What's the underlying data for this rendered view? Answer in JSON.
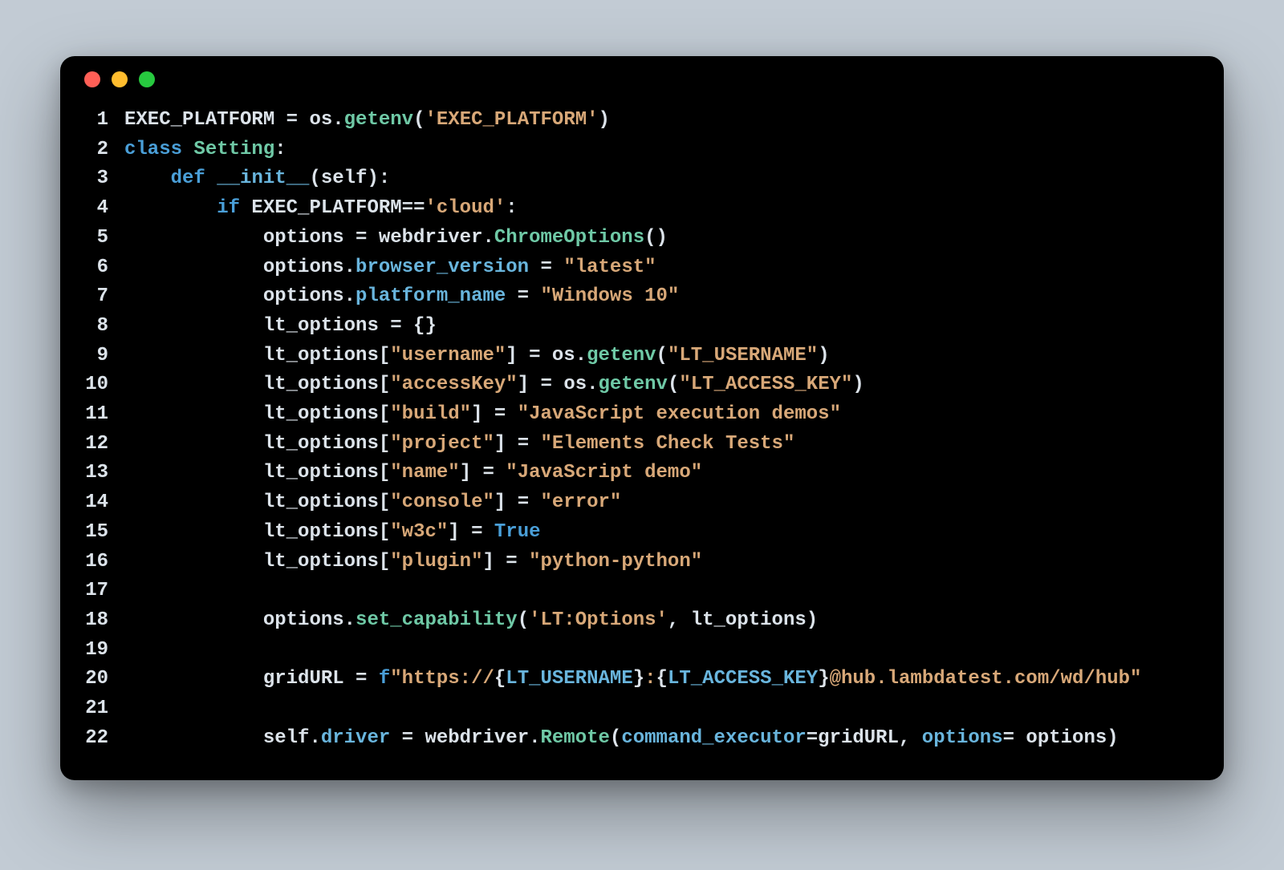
{
  "window": {
    "traffic_lights": [
      "red",
      "yellow",
      "green"
    ]
  },
  "code": {
    "lines": [
      {
        "n": "1",
        "tokens": [
          {
            "t": "EXEC_PLATFORM = os.",
            "c": "tok-id"
          },
          {
            "t": "getenv",
            "c": "tok-fn"
          },
          {
            "t": "(",
            "c": "tok-id"
          },
          {
            "t": "'EXEC_PLATFORM'",
            "c": "tok-str"
          },
          {
            "t": ")",
            "c": "tok-id"
          }
        ]
      },
      {
        "n": "2",
        "tokens": [
          {
            "t": "class",
            "c": "tok-kw"
          },
          {
            "t": " ",
            "c": "tok-id"
          },
          {
            "t": "Setting",
            "c": "tok-cls"
          },
          {
            "t": ":",
            "c": "tok-id"
          }
        ]
      },
      {
        "n": "3",
        "tokens": [
          {
            "t": "    ",
            "c": "tok-id"
          },
          {
            "t": "def",
            "c": "tok-kw"
          },
          {
            "t": " ",
            "c": "tok-id"
          },
          {
            "t": "__init__",
            "c": "tok-attr"
          },
          {
            "t": "(",
            "c": "tok-id"
          },
          {
            "t": "self",
            "c": "tok-id"
          },
          {
            "t": "):",
            "c": "tok-id"
          }
        ]
      },
      {
        "n": "4",
        "tokens": [
          {
            "t": "        ",
            "c": "tok-id"
          },
          {
            "t": "if",
            "c": "tok-kw"
          },
          {
            "t": " EXEC_PLATFORM==",
            "c": "tok-id"
          },
          {
            "t": "'cloud'",
            "c": "tok-str"
          },
          {
            "t": ":",
            "c": "tok-id"
          }
        ]
      },
      {
        "n": "5",
        "tokens": [
          {
            "t": "            options = webdriver.",
            "c": "tok-id"
          },
          {
            "t": "ChromeOptions",
            "c": "tok-cls"
          },
          {
            "t": "()",
            "c": "tok-id"
          }
        ]
      },
      {
        "n": "6",
        "tokens": [
          {
            "t": "            options.",
            "c": "tok-id"
          },
          {
            "t": "browser_version",
            "c": "tok-attr"
          },
          {
            "t": " = ",
            "c": "tok-id"
          },
          {
            "t": "\"latest\"",
            "c": "tok-str"
          }
        ]
      },
      {
        "n": "7",
        "tokens": [
          {
            "t": "            options.",
            "c": "tok-id"
          },
          {
            "t": "platform_name",
            "c": "tok-attr"
          },
          {
            "t": " = ",
            "c": "tok-id"
          },
          {
            "t": "\"Windows 10\"",
            "c": "tok-str"
          }
        ]
      },
      {
        "n": "8",
        "tokens": [
          {
            "t": "            lt_options = {}",
            "c": "tok-id"
          }
        ]
      },
      {
        "n": "9",
        "tokens": [
          {
            "t": "            lt_options[",
            "c": "tok-id"
          },
          {
            "t": "\"username\"",
            "c": "tok-str"
          },
          {
            "t": "] = os.",
            "c": "tok-id"
          },
          {
            "t": "getenv",
            "c": "tok-fn"
          },
          {
            "t": "(",
            "c": "tok-id"
          },
          {
            "t": "\"LT_USERNAME\"",
            "c": "tok-str"
          },
          {
            "t": ")",
            "c": "tok-id"
          }
        ]
      },
      {
        "n": "10",
        "tokens": [
          {
            "t": "            lt_options[",
            "c": "tok-id"
          },
          {
            "t": "\"accessKey\"",
            "c": "tok-str"
          },
          {
            "t": "] = os.",
            "c": "tok-id"
          },
          {
            "t": "getenv",
            "c": "tok-fn"
          },
          {
            "t": "(",
            "c": "tok-id"
          },
          {
            "t": "\"LT_ACCESS_KEY\"",
            "c": "tok-str"
          },
          {
            "t": ")",
            "c": "tok-id"
          }
        ]
      },
      {
        "n": "11",
        "tokens": [
          {
            "t": "            lt_options[",
            "c": "tok-id"
          },
          {
            "t": "\"build\"",
            "c": "tok-str"
          },
          {
            "t": "] = ",
            "c": "tok-id"
          },
          {
            "t": "\"JavaScript execution demos\"",
            "c": "tok-str"
          }
        ]
      },
      {
        "n": "12",
        "tokens": [
          {
            "t": "            lt_options[",
            "c": "tok-id"
          },
          {
            "t": "\"project\"",
            "c": "tok-str"
          },
          {
            "t": "] = ",
            "c": "tok-id"
          },
          {
            "t": "\"Elements Check Tests\"",
            "c": "tok-str"
          }
        ]
      },
      {
        "n": "13",
        "tokens": [
          {
            "t": "            lt_options[",
            "c": "tok-id"
          },
          {
            "t": "\"name\"",
            "c": "tok-str"
          },
          {
            "t": "] = ",
            "c": "tok-id"
          },
          {
            "t": "\"JavaScript demo\"",
            "c": "tok-str"
          }
        ]
      },
      {
        "n": "14",
        "tokens": [
          {
            "t": "            lt_options[",
            "c": "tok-id"
          },
          {
            "t": "\"console\"",
            "c": "tok-str"
          },
          {
            "t": "] = ",
            "c": "tok-id"
          },
          {
            "t": "\"error\"",
            "c": "tok-str"
          }
        ]
      },
      {
        "n": "15",
        "tokens": [
          {
            "t": "            lt_options[",
            "c": "tok-id"
          },
          {
            "t": "\"w3c\"",
            "c": "tok-str"
          },
          {
            "t": "] = ",
            "c": "tok-id"
          },
          {
            "t": "True",
            "c": "tok-kw"
          }
        ]
      },
      {
        "n": "16",
        "tokens": [
          {
            "t": "            lt_options[",
            "c": "tok-id"
          },
          {
            "t": "\"plugin\"",
            "c": "tok-str"
          },
          {
            "t": "] = ",
            "c": "tok-id"
          },
          {
            "t": "\"python-python\"",
            "c": "tok-str"
          }
        ]
      },
      {
        "n": "17",
        "tokens": [
          {
            "t": " ",
            "c": "tok-id"
          }
        ]
      },
      {
        "n": "18",
        "tokens": [
          {
            "t": "            options.",
            "c": "tok-id"
          },
          {
            "t": "set_capability",
            "c": "tok-fn"
          },
          {
            "t": "(",
            "c": "tok-id"
          },
          {
            "t": "'LT:Options'",
            "c": "tok-str"
          },
          {
            "t": ", lt_options)",
            "c": "tok-id"
          }
        ]
      },
      {
        "n": "19",
        "tokens": [
          {
            "t": " ",
            "c": "tok-id"
          }
        ]
      },
      {
        "n": "20",
        "tokens": [
          {
            "t": "            gridURL = ",
            "c": "tok-id"
          },
          {
            "t": "f",
            "c": "tok-fpre"
          },
          {
            "t": "\"https://",
            "c": "tok-str"
          },
          {
            "t": "{",
            "c": "tok-id"
          },
          {
            "t": "LT_USERNAME",
            "c": "tok-attr"
          },
          {
            "t": "}",
            "c": "tok-id"
          },
          {
            "t": ":",
            "c": "tok-str"
          },
          {
            "t": "{",
            "c": "tok-id"
          },
          {
            "t": "LT_ACCESS_KEY",
            "c": "tok-attr"
          },
          {
            "t": "}",
            "c": "tok-id"
          },
          {
            "t": "@hub.lambdatest.com/wd/hub\"",
            "c": "tok-str"
          }
        ]
      },
      {
        "n": "21",
        "tokens": [
          {
            "t": " ",
            "c": "tok-id"
          }
        ]
      },
      {
        "n": "22",
        "tokens": [
          {
            "t": "            self.",
            "c": "tok-id"
          },
          {
            "t": "driver",
            "c": "tok-attr"
          },
          {
            "t": " = webdriver.",
            "c": "tok-id"
          },
          {
            "t": "Remote",
            "c": "tok-cls"
          },
          {
            "t": "(",
            "c": "tok-id"
          },
          {
            "t": "command_executor",
            "c": "tok-attr"
          },
          {
            "t": "=gridURL, ",
            "c": "tok-id"
          },
          {
            "t": "options",
            "c": "tok-attr"
          },
          {
            "t": "= options)",
            "c": "tok-id"
          }
        ]
      }
    ]
  }
}
